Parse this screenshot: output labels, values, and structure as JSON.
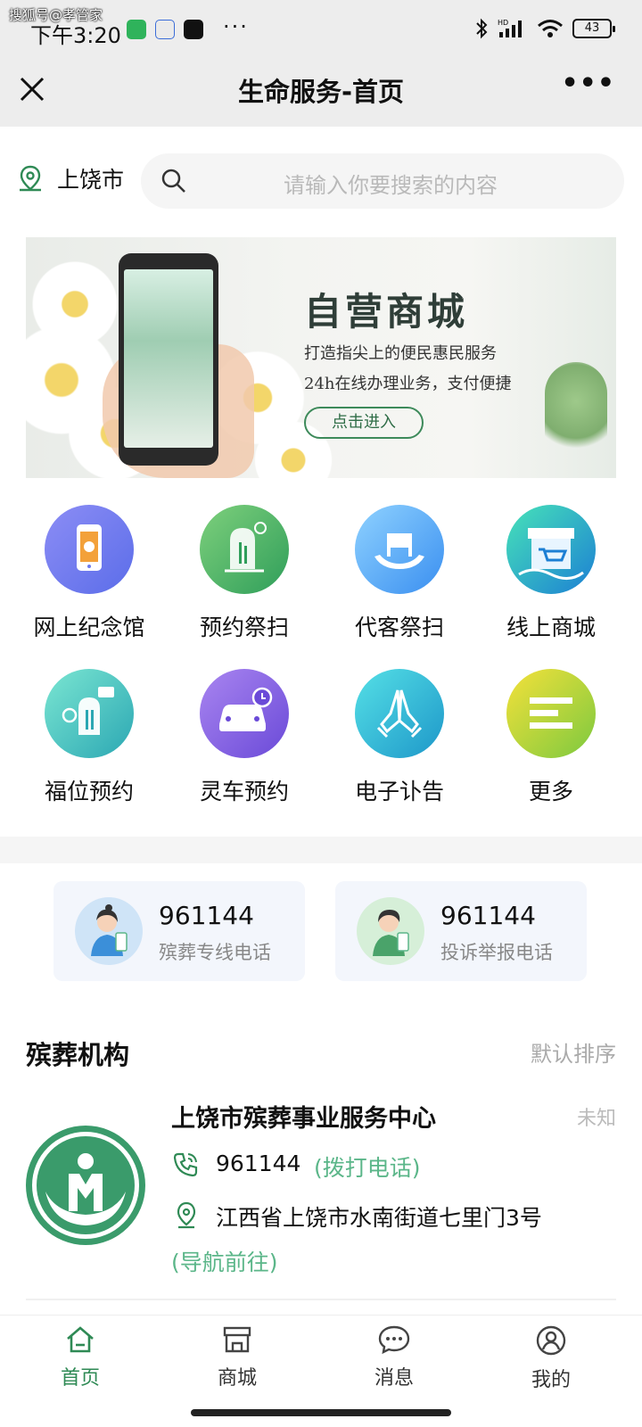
{
  "status_bar": {
    "watermark": "搜狐号@孝管家",
    "time": "下午3:20",
    "battery": "43"
  },
  "title_bar": {
    "title": "生命服务-首页"
  },
  "location": {
    "city": "上饶市"
  },
  "search": {
    "placeholder": "请输入你要搜索的内容"
  },
  "banner": {
    "title": "自营商城",
    "line1": "打造指尖上的便民惠民服务",
    "line2": "24h在线办理业务，支付便捷",
    "button": "点击进入"
  },
  "services": [
    {
      "label": "网上纪念馆",
      "icon": "memorial-phone-icon"
    },
    {
      "label": "预约祭扫",
      "icon": "tomb-sweep-icon"
    },
    {
      "label": "代客祭扫",
      "icon": "proxy-sweep-icon"
    },
    {
      "label": "线上商城",
      "icon": "online-store-icon"
    },
    {
      "label": "福位预约",
      "icon": "niche-reservation-icon"
    },
    {
      "label": "灵车预约",
      "icon": "hearse-icon"
    },
    {
      "label": "电子讣告",
      "icon": "praying-hands-icon"
    },
    {
      "label": "更多",
      "icon": "more-menu-icon"
    }
  ],
  "hotlines": [
    {
      "number": "961144",
      "label": "殡葬专线电话"
    },
    {
      "number": "961144",
      "label": "投诉举报电话"
    }
  ],
  "institutions": {
    "title": "殡葬机构",
    "sort": "默认排序",
    "items": [
      {
        "name": "上饶市殡葬事业服务中心",
        "status": "未知",
        "phone": "961144",
        "call_label": "(拨打电话)",
        "address": "江西省上饶市水南街道七里门3号",
        "nav_label": "(导航前往)"
      }
    ]
  },
  "tabbar": [
    {
      "label": "首页",
      "icon": "home-icon"
    },
    {
      "label": "商城",
      "icon": "store-icon"
    },
    {
      "label": "消息",
      "icon": "message-icon"
    },
    {
      "label": "我的",
      "icon": "profile-icon"
    }
  ],
  "colors": {
    "accent": "#2f8a55",
    "link": "#5bb689"
  }
}
